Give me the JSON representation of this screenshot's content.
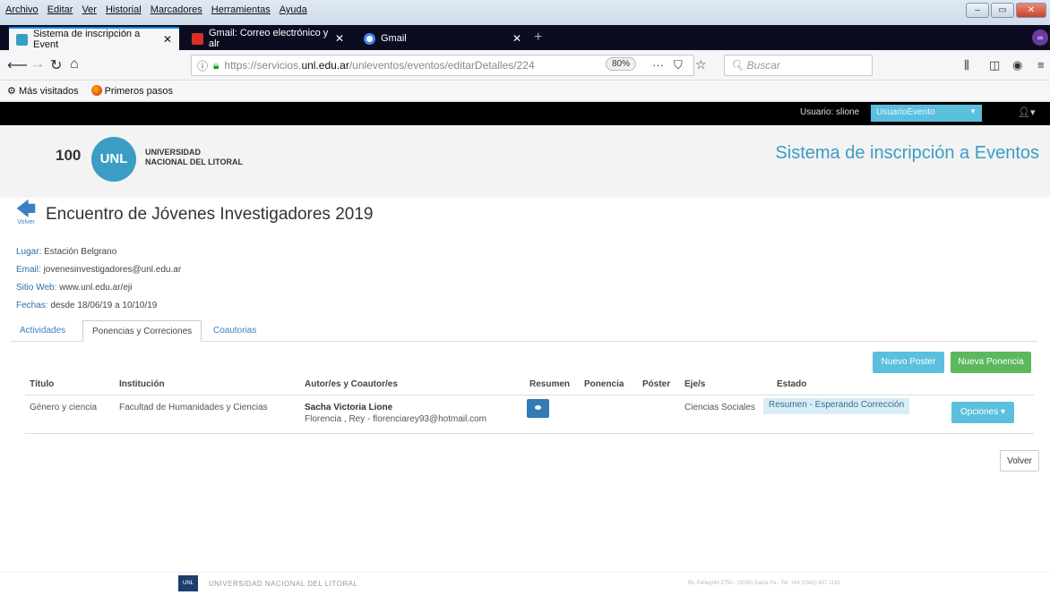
{
  "browser": {
    "menu": [
      "Archivo",
      "Editar",
      "Ver",
      "Historial",
      "Marcadores",
      "Herramientas",
      "Ayuda"
    ],
    "tabs": [
      {
        "title": "Sistema de inscripción a Event",
        "active": true
      },
      {
        "title": "Gmail: Correo electrónico y alr",
        "active": false
      },
      {
        "title": "Gmail",
        "active": false
      }
    ],
    "url_prefix": "https://servicios.",
    "url_host": "unl.edu.ar",
    "url_path": "/unleventos/eventos/editarDetalles/224",
    "zoom": "80%",
    "search_placeholder": "Buscar",
    "bookmarks": [
      "Más visitados",
      "Primeros pasos"
    ]
  },
  "topbar": {
    "user_label": "Usuario: slione",
    "user_role": "UsuarioEvento"
  },
  "header": {
    "logo_100": "100",
    "logo_unl": "UNL",
    "logo_line1": "UNIVERSIDAD",
    "logo_line2": "NACIONAL DEL LITORAL",
    "system_title": "Sistema de inscripción a Eventos"
  },
  "event": {
    "back_label": "Volver",
    "title": "Encuentro de Jóvenes Investigadores 2019",
    "lugar_k": "Lugar:",
    "lugar_v": "Estación Belgrano",
    "email_k": "Email:",
    "email_v": "jovenesinvestigadores@unl.edu.ar",
    "web_k": "Sitio Web:",
    "web_v": "www.unl.edu.ar/eji",
    "fechas_k": "Fechas:",
    "fechas_v": "desde 18/06/19 a 10/10/19"
  },
  "tabs": [
    "Actividades",
    "Ponencias y Correciones",
    "Coautorias"
  ],
  "actions": {
    "nuevo_poster": "Nuevo Poster",
    "nueva_ponencia": "Nueva Ponencia",
    "volver": "Volver"
  },
  "table": {
    "headers": [
      "Título",
      "Institución",
      "Autor/es y Coautor/es",
      "Resumen",
      "Ponencia",
      "Póster",
      "Eje/s",
      "Estado"
    ],
    "rows": [
      {
        "titulo": "Género y ciencia",
        "institucion": "Facultad de Humanidades y Ciencias",
        "autor": "Sacha Victoria Lione",
        "coautores": "Florencia , Rey - florenciarey93@hotmail.com",
        "eje": "Ciencias Sociales",
        "estado": "Resumen - Esperando Corrección",
        "opciones": "Opciones"
      }
    ]
  },
  "footer": {
    "logo": "UNL",
    "name": "UNIVERSIDAD NACIONAL DEL LITORAL",
    "address": "Bv. Pellegrini 2750 - (3000) Santa Fe - Tel: +54 (0342) 457 1110"
  },
  "colors": {
    "accent": "#3b9cc4",
    "info_button": "#5bc0de",
    "success_button": "#5cb85c",
    "primary_button": "#337ab7"
  }
}
